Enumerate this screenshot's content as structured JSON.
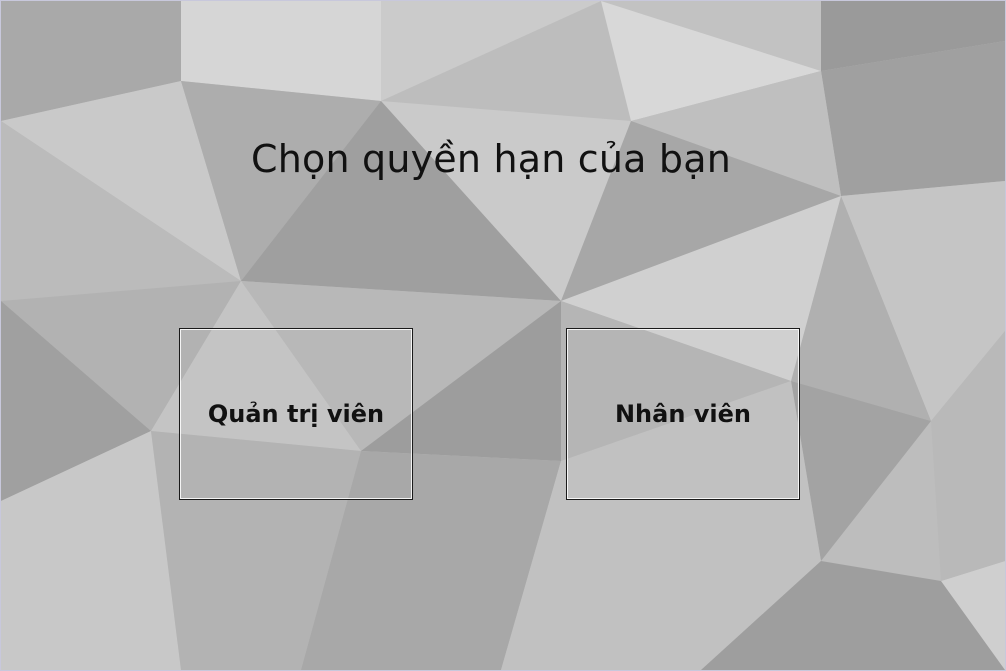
{
  "screen": {
    "title": "Chọn quyền hạn của bạn"
  },
  "roles": [
    {
      "label": "Quản trị viên"
    },
    {
      "label": "Nhân viên"
    }
  ],
  "colors": {
    "text": "#111111",
    "background": "#bdbdbd",
    "button_border": "#1a1a1a"
  }
}
